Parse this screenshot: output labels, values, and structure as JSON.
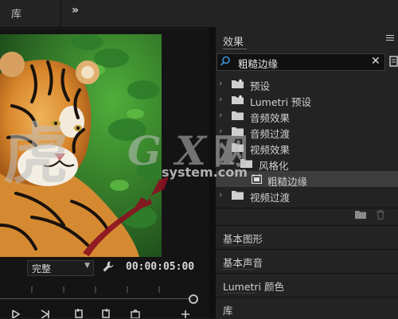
{
  "top_bar": {
    "tab_label": "库",
    "overflow_label": "»"
  },
  "monitor": {
    "fit_value": "完整",
    "timecode": "00:00:05:00",
    "image_subject": "tiger"
  },
  "effects_panel": {
    "title": "效果",
    "search_value": "粗糙边缘",
    "tree": [
      {
        "label": "预设",
        "icon": "preset-bin-icon",
        "expanded": false
      },
      {
        "label": "Lumetri 预设",
        "icon": "preset-bin-icon",
        "expanded": false
      },
      {
        "label": "音频效果",
        "icon": "folder-icon",
        "expanded": false
      },
      {
        "label": "音频过渡",
        "icon": "folder-icon",
        "expanded": false
      },
      {
        "label": "视频效果",
        "icon": "folder-icon",
        "expanded": true
      },
      {
        "label": "风格化",
        "icon": "folder-icon",
        "expanded": true
      },
      {
        "label": "粗糙边缘",
        "icon": "effect-icon",
        "selected": true
      },
      {
        "label": "视频过渡",
        "icon": "folder-icon",
        "expanded": false
      }
    ]
  },
  "sections": [
    {
      "label": "基本图形"
    },
    {
      "label": "基本声音"
    },
    {
      "label": "Lumetri 颜色"
    },
    {
      "label": "库"
    }
  ],
  "watermark": {
    "glyph": "虎",
    "latin": "G X I",
    "cjk": "网",
    "domain": "system.com"
  },
  "colors": {
    "bg": "#1d1d1d",
    "panel": "#232323",
    "selection": "#3d3d3d",
    "accent": "#3a8fd6",
    "arrow": "#8b1020"
  }
}
